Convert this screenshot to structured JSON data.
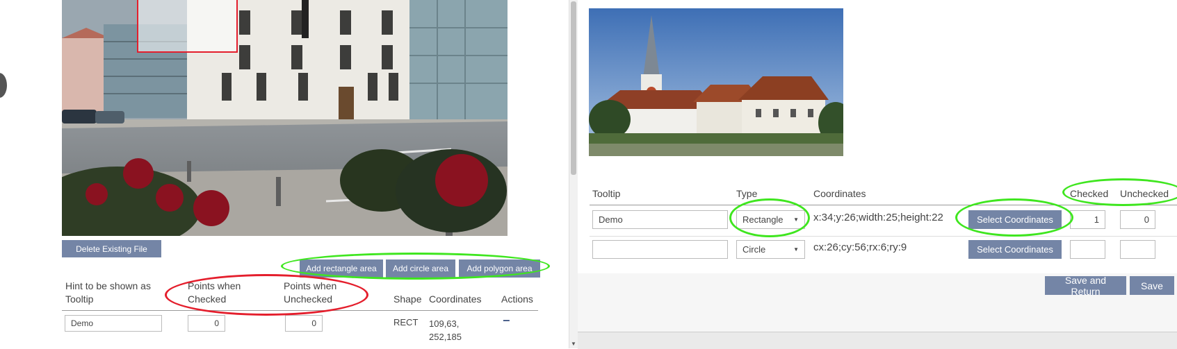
{
  "left": {
    "delete_button": "Delete Existing File",
    "add_buttons": [
      "Add rectangle area",
      "Add circle area",
      "Add polygon area"
    ],
    "headers": {
      "hint": "Hint to be shown as Tooltip",
      "checked": "Points when Checked",
      "unchecked": "Points when Unchecked",
      "shape": "Shape",
      "coordinates": "Coordinates",
      "actions": "Actions"
    },
    "row": {
      "tooltip": "Demo",
      "checked": "0",
      "unchecked": "0",
      "shape": "RECT",
      "coordinates": "109,63, 252,185",
      "action": "−"
    }
  },
  "right": {
    "headers": {
      "tooltip": "Tooltip",
      "type": "Type",
      "coordinates": "Coordinates",
      "checked": "Checked",
      "unchecked": "Unchecked"
    },
    "rows": [
      {
        "tooltip": "Demo",
        "type": "Rectangle",
        "coordinates": "x:34;y:26;width:25;height:22",
        "select": "Select Coordinates",
        "checked": "1",
        "unchecked": "0"
      },
      {
        "tooltip": "",
        "type": "Circle",
        "coordinates": "cx:26;cy:56;rx:6;ry:9",
        "select": "Select Coordinates",
        "checked": "",
        "unchecked": ""
      }
    ],
    "save_return": "Save and Return",
    "save": "Save"
  },
  "colors": {
    "button_bg": "#7485a6",
    "highlight_green": "#3fe61f",
    "highlight_red": "#e41e2c"
  },
  "icons": {
    "select_arrow": "▼",
    "scroll_down": "▼"
  }
}
